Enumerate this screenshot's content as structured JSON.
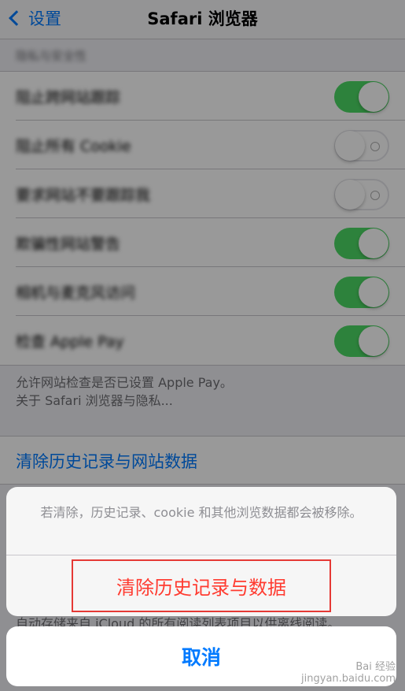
{
  "navbar": {
    "back_label": "设置",
    "title": "Safari 浏览器"
  },
  "privacy": {
    "section_header": "隐私与安全性",
    "rows": [
      {
        "label": "阻止跨网站跟踪",
        "on": true
      },
      {
        "label": "阻止所有 Cookie",
        "on": false
      },
      {
        "label": "要求网站不要跟踪我",
        "on": false
      },
      {
        "label": "欺骗性网站警告",
        "on": true
      },
      {
        "label": "相机与麦克风访问",
        "on": true
      },
      {
        "label": "检查 Apple Pay",
        "on": true
      }
    ],
    "footer_line1": "允许网站检查是否已设置 Apple Pay。",
    "footer_line2": "关于 Safari 浏览器与隐私..."
  },
  "clear_link": "清除历史记录与网站数据",
  "offline_note": "自动存储来自 iCloud 的所有阅读列表项目以供离线阅读。",
  "action_sheet": {
    "message": "若清除，历史记录、cookie 和其他浏览数据都会被移除。",
    "destructive_label": "清除历史记录与数据",
    "cancel_label": "取消"
  },
  "watermark": {
    "line1": "Bai 经验",
    "line2": "jingyan.baidu.com"
  },
  "colors": {
    "accent": "#007aff",
    "destructive": "#ff3b30",
    "toggle_on": "#4cd964"
  }
}
